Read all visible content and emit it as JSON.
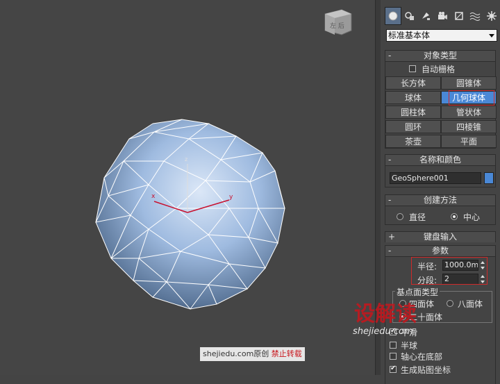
{
  "viewport": {
    "viewcube_text": "左 后",
    "axis_labels": {
      "x": "x",
      "y": "y",
      "z": "z"
    },
    "colors": {
      "sphere": "#9fbbe0",
      "wire": "#ffffff",
      "axis": "#c8102e"
    }
  },
  "panel": {
    "tab_icons": [
      "geometry-icon",
      "shapes-icon",
      "lights-icon",
      "cameras-icon",
      "helpers-icon",
      "spacewarps-icon",
      "systems-icon"
    ],
    "dropdown_value": "标准基本体",
    "object_type": {
      "header": "对象类型",
      "sign": "-",
      "autogrid_label": "自动栅格",
      "buttons": [
        "长方体",
        "圆锥体",
        "球体",
        "几何球体",
        "圆柱体",
        "管状体",
        "圆环",
        "四棱锥",
        "茶壶",
        "平面"
      ],
      "selected": "几何球体"
    },
    "name_color": {
      "header": "名称和颜色",
      "sign": "-",
      "name": "GeoSphere001",
      "swatch_color": "#4a88d6"
    },
    "creation_method": {
      "header": "创建方法",
      "sign": "-",
      "option_diameter": "直径",
      "option_center": "中心"
    },
    "keyboard_entry": {
      "header": "键盘输入",
      "sign": "+"
    },
    "parameters": {
      "header": "参数",
      "sign": "-",
      "radius_label": "半径:",
      "radius_value": "1000.0mm",
      "segments_label": "分段:",
      "segments_value": "2",
      "base_type_label": "基点面类型",
      "option_tetra": "四面体",
      "option_octa": "八面体",
      "option_icosa": "二十面体",
      "smooth_label": "平滑",
      "hemisphere_label": "半球",
      "base_pivot_label": "轴心在底部",
      "gen_mapping_label": "生成贴图坐标"
    }
  },
  "watermark": {
    "site": "shejiedu.com原创",
    "notice": "禁止转载",
    "logo_text": "设解读",
    "logo_url_text": "shejiedu.com"
  }
}
